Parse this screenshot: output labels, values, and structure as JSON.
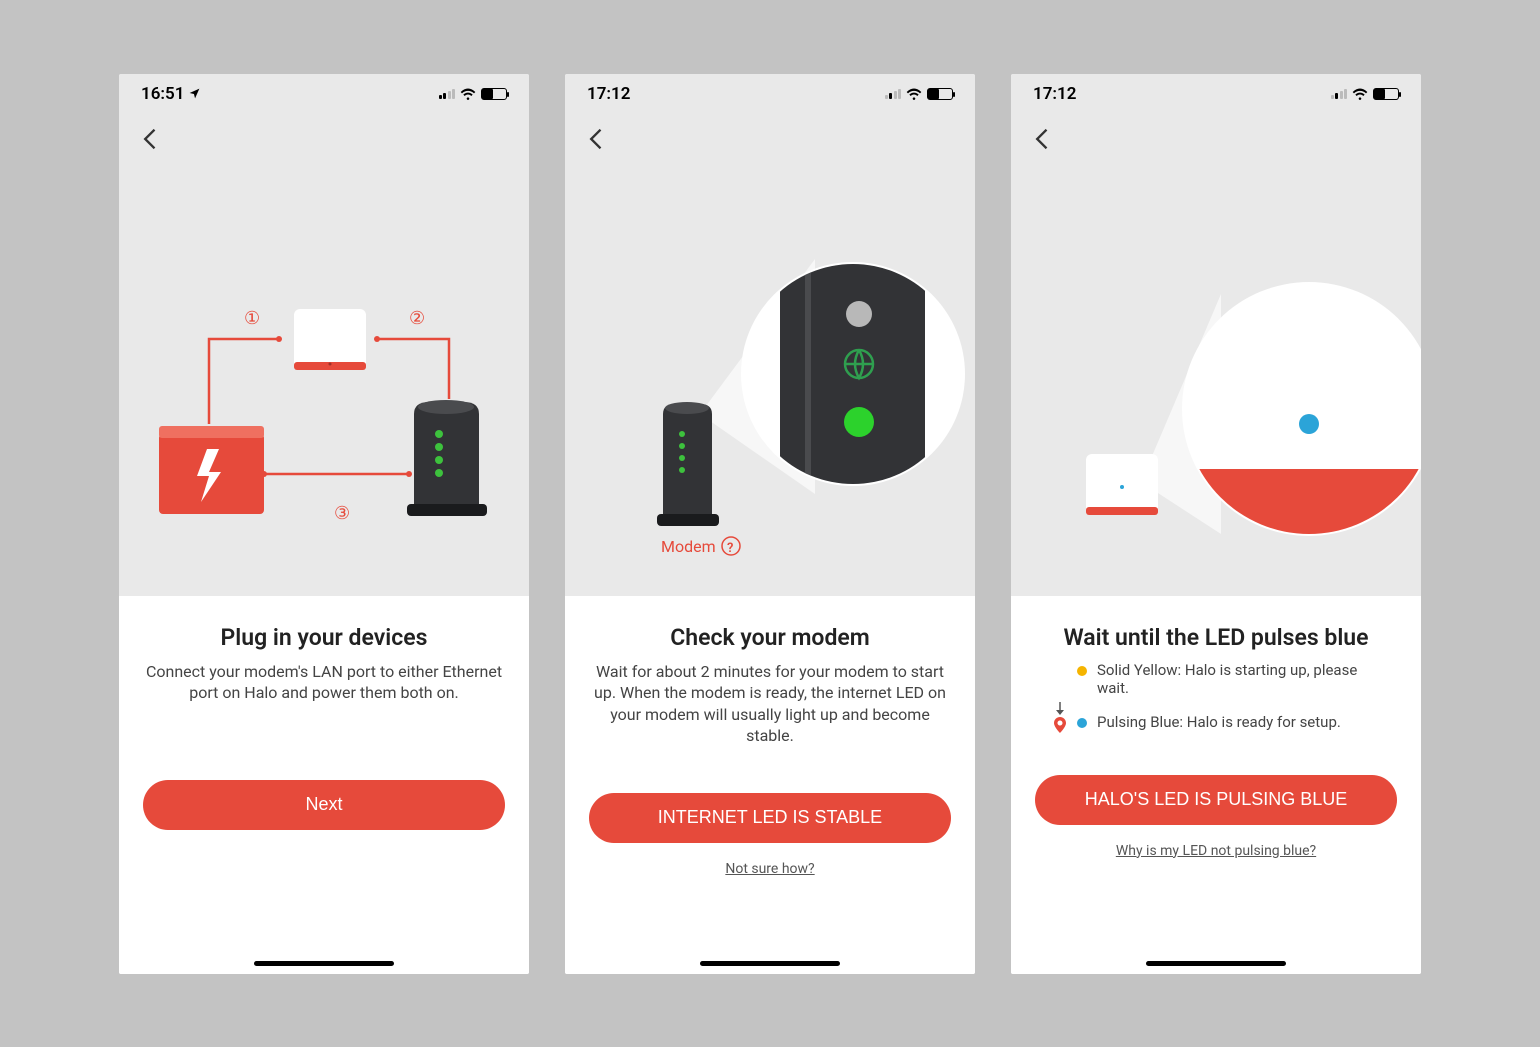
{
  "colors": {
    "accent": "#e64a3b",
    "yellow": "#f5b400",
    "blue": "#2ba4d8",
    "green": "#3dc23d",
    "dark": "#323336"
  },
  "screens": [
    {
      "status_time": "16:51",
      "location_indicator": true,
      "title": "Plug in your devices",
      "desc": "Connect your modem's LAN port to either Ethernet port on Halo and power them both on.",
      "button": "Next",
      "link": "",
      "illustration": {
        "step1": "①",
        "step2": "②",
        "step3": "③"
      }
    },
    {
      "status_time": "17:12",
      "location_indicator": false,
      "title": "Check your modem",
      "desc": "Wait for about 2 minutes for your modem to start up. When the modem is ready, the internet LED on your modem will usually light up and become stable.",
      "button": "INTERNET LED IS STABLE",
      "link": "Not sure how?",
      "modem_label": "Modem"
    },
    {
      "status_time": "17:12",
      "location_indicator": false,
      "title": "Wait until the LED pulses blue",
      "desc": "",
      "button": "HALO'S LED IS PULSING BLUE",
      "link": "Why is my LED not pulsing blue?",
      "legend": [
        {
          "color": "#f5b400",
          "text": "Solid Yellow: Halo is starting up, please wait.",
          "left_icon": "arrow-down"
        },
        {
          "color": "#2ba4d8",
          "text": "Pulsing Blue: Halo is ready for setup.",
          "left_icon": "pin"
        }
      ]
    }
  ]
}
